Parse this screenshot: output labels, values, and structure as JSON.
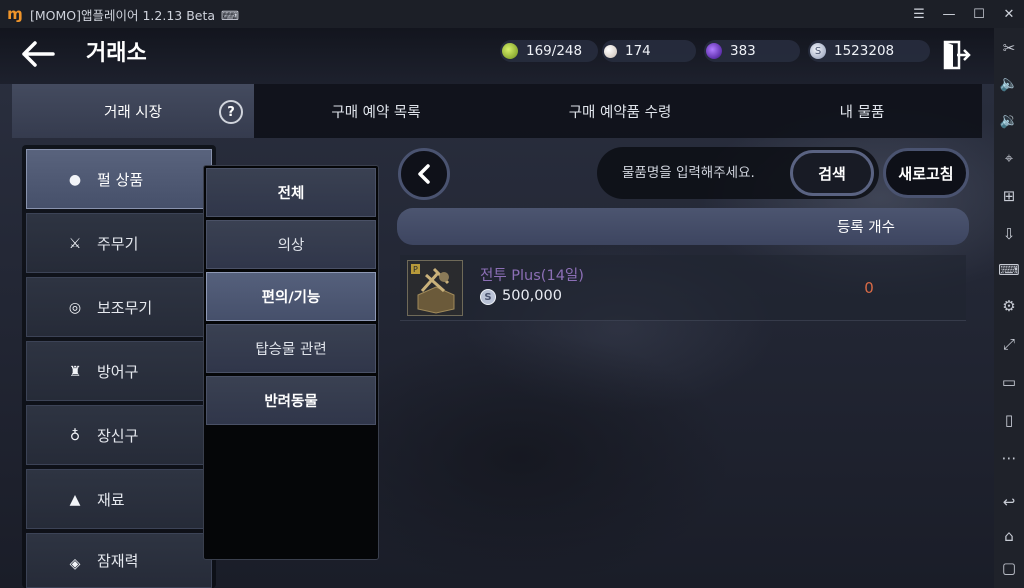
{
  "window": {
    "title": "[MOMO]앱플레이어 1.2.13 Beta",
    "controls": [
      "menu-icon",
      "minimize-icon",
      "maximize-icon",
      "close-icon"
    ]
  },
  "header": {
    "title": "거래소",
    "resources": [
      {
        "icon": "energy-icon",
        "value": "169/248",
        "color": "#9ac43b"
      },
      {
        "icon": "pearl-icon",
        "value": "174",
        "color": "#e8e0d8"
      },
      {
        "icon": "dark-orb-icon",
        "value": "383",
        "color": "#6a2bd0"
      },
      {
        "icon": "silver-coin-icon",
        "value": "1523208",
        "color": "#c5cbe0"
      }
    ]
  },
  "tabs": [
    {
      "label": "거래 시장",
      "active": true
    },
    {
      "label": "구매 예약 목록",
      "active": false
    },
    {
      "label": "구매 예약품 수령",
      "active": false
    },
    {
      "label": "내 물품",
      "active": false
    }
  ],
  "help_label": "?",
  "categories": [
    {
      "label": "펄 상품",
      "icon": "pearl-icon",
      "active": true
    },
    {
      "label": "주무기",
      "icon": "crossed-swords-icon",
      "active": false
    },
    {
      "label": "보조무기",
      "icon": "shield-icon",
      "active": false
    },
    {
      "label": "방어구",
      "icon": "armor-icon",
      "active": false
    },
    {
      "label": "장신구",
      "icon": "ring-icon",
      "active": false
    },
    {
      "label": "재료",
      "icon": "flask-icon",
      "active": false
    },
    {
      "label": "잠재력",
      "icon": "potential-icon",
      "active": false
    }
  ],
  "subcategories": [
    {
      "label": "전체",
      "active": false
    },
    {
      "label": "의상",
      "active": false
    },
    {
      "label": "편의/기능",
      "active": true
    },
    {
      "label": "탑승물 관련",
      "active": false
    },
    {
      "label": "반려동물",
      "active": false
    }
  ],
  "search": {
    "placeholder": "물품명을 입력해주세요.",
    "button": "검색",
    "refresh": "새로고침"
  },
  "list": {
    "column": "등록 개수",
    "items": [
      {
        "name": "전투 Plus(14일)",
        "price": "500,000",
        "count": "0"
      }
    ]
  },
  "colors": {
    "accent_tab": "#444b5f",
    "item_name": "#8c6fb6",
    "count": "#d86a46",
    "app_logo": "#f0952a"
  }
}
